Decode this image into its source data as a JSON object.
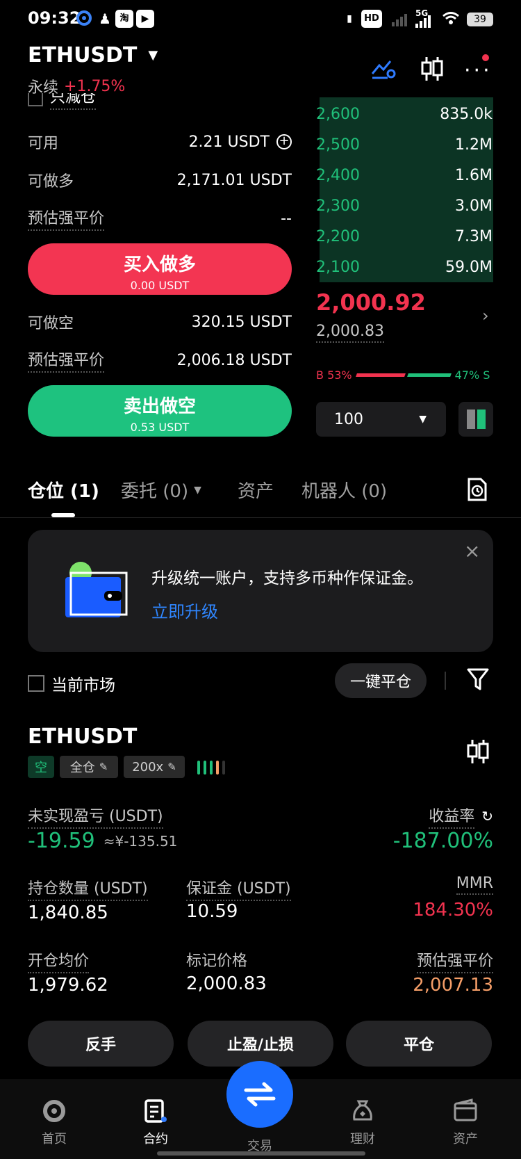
{
  "status_bar": {
    "time": "09:32",
    "battery": "39",
    "network": "5G",
    "hd": "HD"
  },
  "header": {
    "pair": "ETHUSDT",
    "perpetual_label": "永续",
    "change": "+1.75%"
  },
  "form": {
    "reduce_only": "只减仓",
    "available_label": "可用",
    "available_value": "2.21 USDT",
    "can_long_label": "可做多",
    "can_long_value": "2,171.01 USDT",
    "est_liq_label": "预估强平价",
    "est_liq_long_value": "--",
    "buy_button": "买入做多",
    "buy_sub": "0.00 USDT",
    "can_short_label": "可做空",
    "can_short_value": "320.15 USDT",
    "est_liq_short_label": "预估强平价",
    "est_liq_short_value": "2,006.18 USDT",
    "sell_button": "卖出做空",
    "sell_sub": "0.53 USDT"
  },
  "orderbook": {
    "rows": [
      {
        "price": "2,600",
        "amount": "835.0k"
      },
      {
        "price": "2,500",
        "amount": "1.2M"
      },
      {
        "price": "2,400",
        "amount": "1.6M"
      },
      {
        "price": "2,300",
        "amount": "3.0M"
      },
      {
        "price": "2,200",
        "amount": "7.3M"
      },
      {
        "price": "2,100",
        "amount": "59.0M"
      }
    ],
    "last_price": "2,000.92",
    "mark_price": "2,000.83",
    "buy_pct": "B 53%",
    "sell_pct": "47% S",
    "depth_select": "100"
  },
  "tabs": [
    {
      "label": "仓位 (1)"
    },
    {
      "label": "委托 (0)"
    },
    {
      "label": "资产"
    },
    {
      "label": "机器人 (0)"
    }
  ],
  "banner": {
    "text": "升级统一账户，支持多币种作保证金。",
    "link": "立即升级"
  },
  "filters": {
    "current_market": "当前市场",
    "close_all": "一键平仓"
  },
  "position": {
    "symbol": "ETHUSDT",
    "side": "空",
    "margin_mode": "全仓",
    "leverage": "200x",
    "pnl_label": "未实现盈亏 (USDT)",
    "pnl_value": "-19.59",
    "pnl_cny": "≈¥-135.51",
    "roe_label": "收益率",
    "roe_value": "-187.00%",
    "size_label": "持仓数量 (USDT)",
    "size_value": "1,840.85",
    "margin_label": "保证金 (USDT)",
    "margin_value": "10.59",
    "mmr_label": "MMR",
    "mmr_value": "184.30%",
    "entry_label": "开仓均价",
    "entry_value": "1,979.62",
    "mark_label": "标记价格",
    "mark_value": "2,000.83",
    "liq_label": "预估强平价",
    "liq_value": "2,007.13",
    "reverse_btn": "反手",
    "tpsl_btn": "止盈/止损",
    "close_btn": "平仓"
  },
  "nav": {
    "home": "首页",
    "contract": "合约",
    "trade": "交易",
    "finance": "理财",
    "assets": "资产"
  },
  "colors": {
    "green": "#20c07a",
    "red": "#f2334f",
    "blue": "#1a6dff",
    "orange": "#f59e68"
  }
}
